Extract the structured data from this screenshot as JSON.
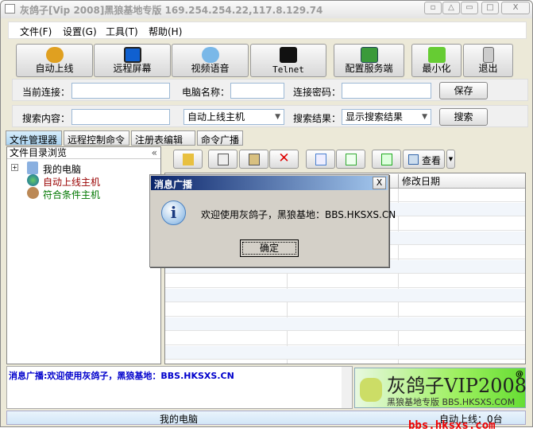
{
  "window": {
    "title": "灰鸽子[Vip 2008]黑狼基地专版  169.254.254.22,117.8.129.74"
  },
  "menu": [
    "文件(F)",
    "设置(G)",
    "工具(T)",
    "帮助(H)"
  ],
  "toolbar": [
    "自动上线",
    "远程屏幕",
    "视频语音",
    "Telnet",
    "配置服务端",
    "最小化",
    "退出"
  ],
  "connection": {
    "current_label": "当前连接：",
    "current_value": "",
    "pcname_label": "电脑名称：",
    "pcname_value": "",
    "password_label": "连接密码：",
    "password_value": "",
    "save": "保存"
  },
  "search": {
    "content_label": "搜索内容：",
    "content_value": "",
    "scope": "自动上线主机",
    "result_label": "搜索结果：",
    "result_value": "显示搜索结果",
    "search": "搜索"
  },
  "tabs": [
    "文件管理器",
    "远程控制命令",
    "注册表编辑器",
    "命令广播"
  ],
  "tree": {
    "header": "文件目录浏览",
    "collapse": "«",
    "items": [
      "我的电脑",
      "自动上线主机",
      "符合条件主机"
    ]
  },
  "filetoolbar": {
    "view": "查看"
  },
  "filelist": {
    "columns": [
      "修改日期"
    ]
  },
  "dialog": {
    "title": "消息广播",
    "message": "欢迎使用灰鸽子，黑狼基地：BBS.HKSXS.CN",
    "ok": "确定",
    "close": "X"
  },
  "broadcast": {
    "text": "消息广播:欢迎使用灰鸽子，黑狼基地：BBS.HKSXS.CN"
  },
  "logo": {
    "title": "灰鸽子VIP2008",
    "sup": "@",
    "sub": "黑狼基地专版 BBS.HKSXS.COM"
  },
  "statusbar": {
    "left": "我的电脑",
    "right": "自动上线：0台"
  },
  "watermark": "bbs.hksxs.com",
  "colors": {
    "accent": "#0a246a",
    "tree_red": "#990000",
    "tree_green": "#007700",
    "broadcast": "#0000cc"
  }
}
